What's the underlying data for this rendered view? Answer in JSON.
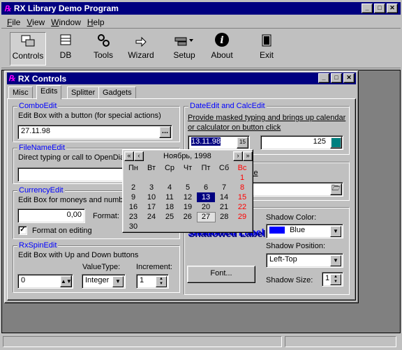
{
  "app": {
    "title": "RX Library Demo Program"
  },
  "menu": [
    "File",
    "View",
    "Window",
    "Help"
  ],
  "toolbar": [
    {
      "label": "Controls",
      "icon": "controls-icon"
    },
    {
      "label": "DB",
      "icon": "db-icon"
    },
    {
      "label": "Tools",
      "icon": "tools-icon"
    },
    {
      "label": "Wizard",
      "icon": "wizard-icon"
    },
    {
      "label": "Setup",
      "icon": "setup-icon"
    },
    {
      "label": "About",
      "icon": "about-icon"
    },
    {
      "label": "Exit",
      "icon": "exit-icon"
    }
  ],
  "child": {
    "title": "RX Controls",
    "tabs": [
      "Misc",
      "Edits",
      "Splitter",
      "Gadgets"
    ],
    "active_tab": "Edits"
  },
  "combo": {
    "title": "ComboEdit",
    "desc": "Edit Box with a button (for special actions)",
    "value": "27.11.98",
    "button": "..."
  },
  "filename": {
    "title": "FileNameEdit",
    "desc": "Direct typing or call to OpenDial",
    "value": ""
  },
  "currency": {
    "title": "CurrencyEdit",
    "desc": "Edit Box for moneys and numbe",
    "value": "0,00",
    "format_label": "Format:",
    "checkbox_label": "Format on editing",
    "checked": true
  },
  "spin": {
    "title": "RxSpinEdit",
    "desc": "Edit Box with Up and Down buttons",
    "value": "0",
    "valuetype_label": "ValueType:",
    "valuetype": "Integer",
    "increment_label": "Increment:",
    "increment": "1"
  },
  "dateedit": {
    "title": "DateEdit and CalcEdit",
    "desc_line1": "Provide masked typing and brings up calendar",
    "desc_line2": "or calculator on button click",
    "date_value": "13.11.98",
    "date_btn": "15",
    "calc_value": "125"
  },
  "dir": {
    "label_tail": "wse"
  },
  "shadow": {
    "label": "Shadowed Label",
    "color_label": "Shadow Color:",
    "color": "Blue",
    "color_swatch": "#0000ff",
    "position_label": "Shadow Position:",
    "position": "Left-Top",
    "size_label": "Shadow Size:",
    "size": "1",
    "font_button": "Font..."
  },
  "calendar": {
    "month": "Ноябрь, 1998",
    "nav_prev_year": "«",
    "nav_prev": "‹",
    "nav_next": "›",
    "nav_next_year": "»",
    "weekdays": [
      "Пн",
      "Вт",
      "Ср",
      "Чт",
      "Пт",
      "Сб",
      "Вс"
    ],
    "weeks": [
      [
        "",
        "",
        "",
        "",
        "",
        "",
        "1"
      ],
      [
        "2",
        "3",
        "4",
        "5",
        "6",
        "7",
        "8"
      ],
      [
        "9",
        "10",
        "11",
        "12",
        "13",
        "14",
        "15"
      ],
      [
        "16",
        "17",
        "18",
        "19",
        "20",
        "21",
        "22"
      ],
      [
        "23",
        "24",
        "25",
        "26",
        "27",
        "28",
        "29"
      ],
      [
        "30",
        "",
        "",
        "",
        "",
        "",
        ""
      ]
    ],
    "selected": "13",
    "today": "27"
  }
}
